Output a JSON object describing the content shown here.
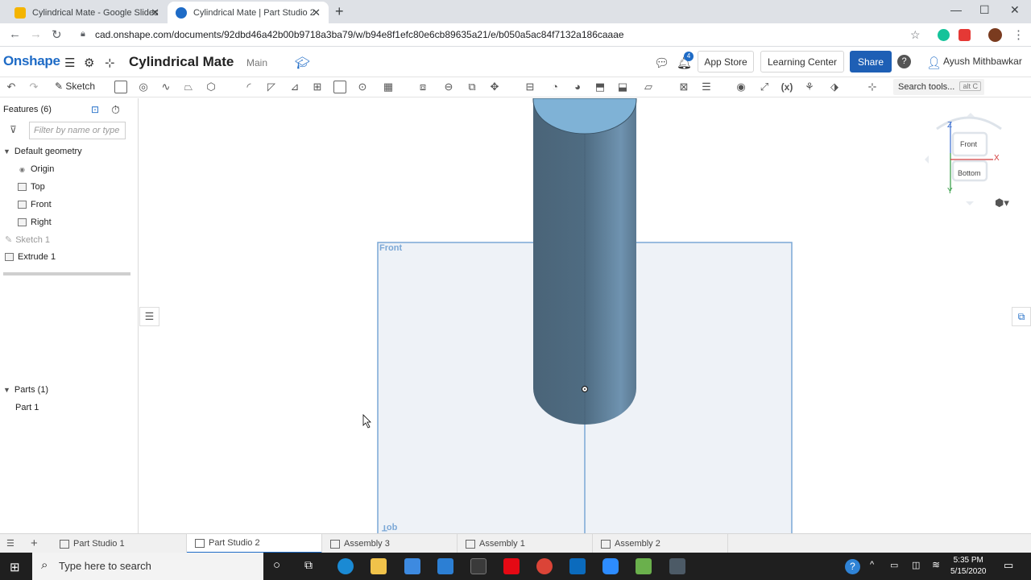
{
  "browser": {
    "tabs": [
      {
        "title": "Cylindrical Mate - Google Slides",
        "close": "✕"
      },
      {
        "title": "Cylindrical Mate | Part Studio 2",
        "close": "✕"
      }
    ],
    "new_tab": "+",
    "url": "cad.onshape.com/documents/92dbd46a42b00b9718a3ba79/w/b94e8f1efc80e6cb89635a21/e/b050a5ac84f7132a186caaae"
  },
  "header": {
    "logo": "Onshape",
    "doc_title": "Cylindrical Mate",
    "doc_workspace": "Main",
    "notification_count": "4",
    "app_store": "App Store",
    "learning_center": "Learning Center",
    "share": "Share",
    "help": "?",
    "user": "Ayush Mithbawkar"
  },
  "toolbar": {
    "sketch": "Sketch",
    "search_placeholder": "Search tools...",
    "search_shortcut": "alt C"
  },
  "features": {
    "title": "Features (6)",
    "filter_placeholder": "Filter by name or type",
    "default_geometry": "Default geometry",
    "items": [
      "Origin",
      "Top",
      "Front",
      "Right"
    ],
    "sketch": "Sketch 1",
    "extrude": "Extrude 1"
  },
  "parts": {
    "title": "Parts (1)",
    "items": [
      "Part 1"
    ]
  },
  "viewport": {
    "plane_front": "Front",
    "plane_top": "Top",
    "cube_front": "Front",
    "cube_bottom": "Bottom",
    "axis_z": "Z",
    "axis_x": "X",
    "axis_y": "Y"
  },
  "bottom_tabs": [
    "Part Studio 1",
    "Part Studio 2",
    "Assembly 3",
    "Assembly 1",
    "Assembly 2"
  ],
  "taskbar": {
    "search": "Type here to search",
    "time": "5:35 PM",
    "date": "5/15/2020"
  },
  "colors": {
    "onshape_blue": "#1e6bc6",
    "cylinder": "#4e6b80",
    "plane_edge": "#7aa7d6"
  }
}
